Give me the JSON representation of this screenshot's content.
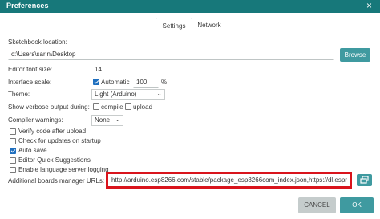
{
  "window": {
    "title": "Preferences",
    "close_glyph": "×"
  },
  "tabs": [
    {
      "label": "Settings",
      "active": true
    },
    {
      "label": "Network",
      "active": false
    }
  ],
  "sketchbook": {
    "label": "Sketchbook location:",
    "value": "c:\\Users\\sarin\\Desktop",
    "button": "Browse"
  },
  "editor_font_size": {
    "label": "Editor font size:",
    "value": "14"
  },
  "interface_scale": {
    "label": "Interface scale:",
    "automatic_label": "Automatic",
    "automatic_checked": true,
    "value": "100",
    "unit": "%"
  },
  "theme": {
    "label": "Theme:",
    "value": "Light (Arduino)"
  },
  "verbose": {
    "label": "Show verbose output during:",
    "compile_label": "compile",
    "upload_label": "upload"
  },
  "compiler_warnings": {
    "label": "Compiler warnings:",
    "value": "None"
  },
  "options": [
    {
      "label": "Verify code after upload",
      "checked": false
    },
    {
      "label": "Check for updates on startup",
      "checked": false
    },
    {
      "label": "Auto save",
      "checked": true
    },
    {
      "label": "Editor Quick Suggestions",
      "checked": false
    },
    {
      "label": "Enable language server logging",
      "checked": false
    }
  ],
  "boards_manager": {
    "label": "Additional boards manager URLs:",
    "value": "http://arduino.esp8266.com/stable/package_esp8266com_index.json,https://dl.espr"
  },
  "footer": {
    "cancel": "CANCEL",
    "ok": "OK"
  },
  "colors": {
    "titlebar": "#17787a",
    "button": "#3f9aa0",
    "checkbox_checked": "#1f6fbf",
    "highlight_border": "#d9141c"
  },
  "icons": {
    "close": "close-icon",
    "chevron": "chevron-down-icon",
    "open_window": "open-window-icon"
  }
}
